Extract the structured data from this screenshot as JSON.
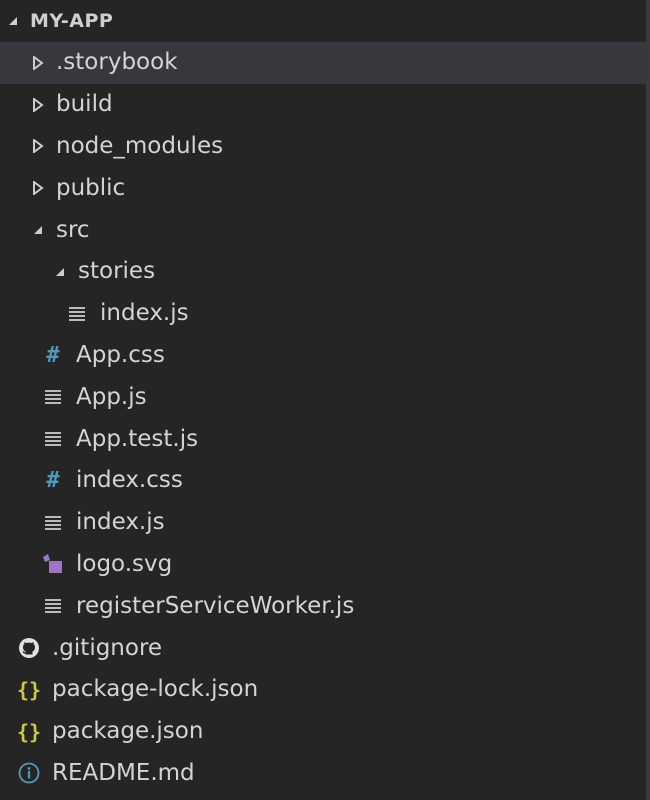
{
  "explorer": {
    "title": "MY-APP"
  },
  "colors": {
    "css": "#519aba",
    "svg": "#a074c4",
    "json": "#cbcb41",
    "info": "#519aba",
    "lines": "#cccccc",
    "git": "#e0e0e0"
  },
  "tree": [
    {
      "label": ".storybook",
      "type": "folder",
      "expanded": false,
      "selected": true
    },
    {
      "label": "build",
      "type": "folder",
      "expanded": false
    },
    {
      "label": "node_modules",
      "type": "folder",
      "expanded": false
    },
    {
      "label": "public",
      "type": "folder",
      "expanded": false
    },
    {
      "label": "src",
      "type": "folder",
      "expanded": true
    },
    {
      "label": "stories",
      "type": "folder",
      "expanded": true
    },
    {
      "label": "index.js",
      "type": "file",
      "icon": "lines-icon"
    },
    {
      "label": "App.css",
      "type": "file",
      "icon": "hash-icon"
    },
    {
      "label": "App.js",
      "type": "file",
      "icon": "lines-icon"
    },
    {
      "label": "App.test.js",
      "type": "file",
      "icon": "lines-icon"
    },
    {
      "label": "index.css",
      "type": "file",
      "icon": "hash-icon"
    },
    {
      "label": "index.js",
      "type": "file",
      "icon": "lines-icon"
    },
    {
      "label": "logo.svg",
      "type": "file",
      "icon": "svg-file-icon"
    },
    {
      "label": "registerServiceWorker.js",
      "type": "file",
      "icon": "lines-icon"
    },
    {
      "label": ".gitignore",
      "type": "file",
      "icon": "github-icon"
    },
    {
      "label": "package-lock.json",
      "type": "file",
      "icon": "braces-icon"
    },
    {
      "label": "package.json",
      "type": "file",
      "icon": "braces-icon"
    },
    {
      "label": "README.md",
      "type": "file",
      "icon": "info-icon"
    }
  ]
}
